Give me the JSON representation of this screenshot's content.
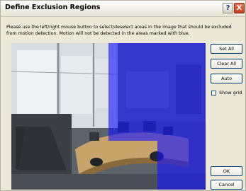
{
  "window": {
    "title": "Define Exclusion Regions",
    "help_label": "?",
    "close_label": "X"
  },
  "instructions": "Please use the left/right mouse button to select/deselect areas in the image that should be excluded from motion detection. Motion will not be detected in the areas marked with blue.",
  "grid": {
    "rows": 3,
    "cols": 4,
    "overlay_color": "#1414ff",
    "excluded": [
      [
        false,
        false,
        true,
        true
      ],
      [
        false,
        false,
        true,
        true
      ],
      [
        false,
        false,
        false,
        true
      ]
    ]
  },
  "buttons": {
    "set_all": "Set All",
    "clear_all": "Clear All",
    "auto": "Auto",
    "ok": "OK",
    "cancel": "Cancel"
  },
  "show_grid": {
    "label": "Show grid",
    "checked": false
  }
}
